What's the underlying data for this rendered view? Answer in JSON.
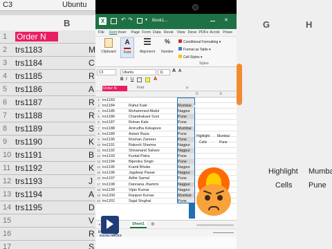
{
  "background": {
    "name_box": "C3",
    "font_name": "Ubuntu",
    "col_b": "B",
    "col_g": "G",
    "col_h": "H",
    "row_numbers": [
      "1",
      "2",
      "3",
      "4",
      "5",
      "6",
      "7",
      "8",
      "9",
      "10",
      "11",
      "12",
      "13",
      "14",
      "15",
      "16",
      "17"
    ],
    "col_a_values": [
      "Order N",
      "trs1183",
      "trs1184",
      "trs1185",
      "trs1186",
      "trs1187",
      "trs1188",
      "trs1189",
      "trs1190",
      "trs1191",
      "trs1192",
      "trs1193",
      "trs1194",
      "trs1195"
    ],
    "col_b_fragments": [
      "R",
      "M",
      "C",
      "R",
      "A",
      "R",
      "R",
      "S",
      "K",
      "B",
      "K",
      "J",
      "A",
      "D",
      "V",
      "R",
      "S"
    ],
    "overlay_highlight": "Highlight",
    "overlay_cells": "Cells",
    "overlay_mumbai": "Mumbai",
    "overlay_pune": "Pune"
  },
  "phone": {
    "title": "Book1...",
    "menu": [
      "File",
      "Hom",
      "Inser",
      "Page",
      "Form",
      "Data",
      "Revie",
      "View",
      "Deve",
      "PDFe",
      "Acrob",
      "Powe"
    ],
    "ribbon": {
      "clipboard": "Clipboard",
      "font": "Font",
      "alignment": "Alignment",
      "number": "Number",
      "conditional_formatting": "Conditional Formatting",
      "format_as_table": "Format as Table",
      "cell_styles": "Cell Styles",
      "styles_group": "Styles"
    },
    "font_panel": {
      "name_box": "C3",
      "font_name": "Ubuntu",
      "font_size": "11",
      "group_label": "Font"
    },
    "columns": {
      "d": "D",
      "e": "E"
    },
    "header_row": {
      "col_a": "Order N"
    },
    "rows": [
      {
        "n": "2",
        "a": "trs1183",
        "b": "",
        "c": ""
      },
      {
        "n": "3",
        "a": "trs1184",
        "b": "Rahul    Kale",
        "c": "Mumbai"
      },
      {
        "n": "4",
        "a": "trs1185",
        "b": "Mohammed Abdul",
        "c": "Nagpur"
      },
      {
        "n": "5",
        "a": "trs1186",
        "b": "Chandrakant   Soni",
        "c": "Pune"
      },
      {
        "n": "6",
        "a": "trs1187",
        "b": "Rohan    Kale",
        "c": "Pune"
      },
      {
        "n": "7",
        "a": "trs1188",
        "b": "Anirudha   Kekapure",
        "c": "Mumbai"
      },
      {
        "n": "8",
        "a": "trs1189",
        "b": "Aslam Raza",
        "c": "Pune"
      },
      {
        "n": "9",
        "a": "trs1190",
        "b": "Roshan Zameer",
        "c": "Pune"
      },
      {
        "n": "10",
        "a": "trs1191",
        "b": "Rakesh Sharma",
        "c": "Nagpur"
      },
      {
        "n": "11",
        "a": "trs1192",
        "b": "Shivanand Sahani",
        "c": "Nagpur"
      },
      {
        "n": "12",
        "a": "trs1193",
        "b": "Kuntal Patra",
        "c": "Pune"
      },
      {
        "n": "13",
        "a": "trs1194",
        "b": "Bijendra Singh",
        "c": "Pune"
      },
      {
        "n": "14",
        "a": "trs1195",
        "b": "Kranti Bhoke",
        "c": "Nagpur"
      },
      {
        "n": "15",
        "a": "trs1196",
        "b": "Jagdeep Pawar",
        "c": "Nagpur"
      },
      {
        "n": "16",
        "a": "trs1197",
        "b": "Adhir Samal",
        "c": "Pune"
      },
      {
        "n": "17",
        "a": "trs1198",
        "b": "Dannana Jhammi",
        "c": "Nagpur"
      },
      {
        "n": "18",
        "a": "trs1199",
        "b": "Vipin  Kumar",
        "c": "Nagpur"
      },
      {
        "n": "19",
        "a": "trs1200",
        "b": "Ranjeet Kumar",
        "c": "Mumbai"
      },
      {
        "n": "20",
        "a": "trs1201",
        "b": "Sajal Singhal",
        "c": "Pune"
      }
    ],
    "side_highlight": "Highlight",
    "side_cells": "Cells",
    "side_mumbai": "Mumbai",
    "side_pune": "Pune",
    "sheet_tab": "Sheet1",
    "status_ready": "Ready"
  },
  "channel_badge": "EXCELTRICKS",
  "colors": {
    "excel_green": "#1e7145",
    "row_highlight": "#e7e7e7",
    "selection_border": "#1f6fb2",
    "order_header": "#e91e63",
    "c_header_bg": "#e91e63"
  }
}
